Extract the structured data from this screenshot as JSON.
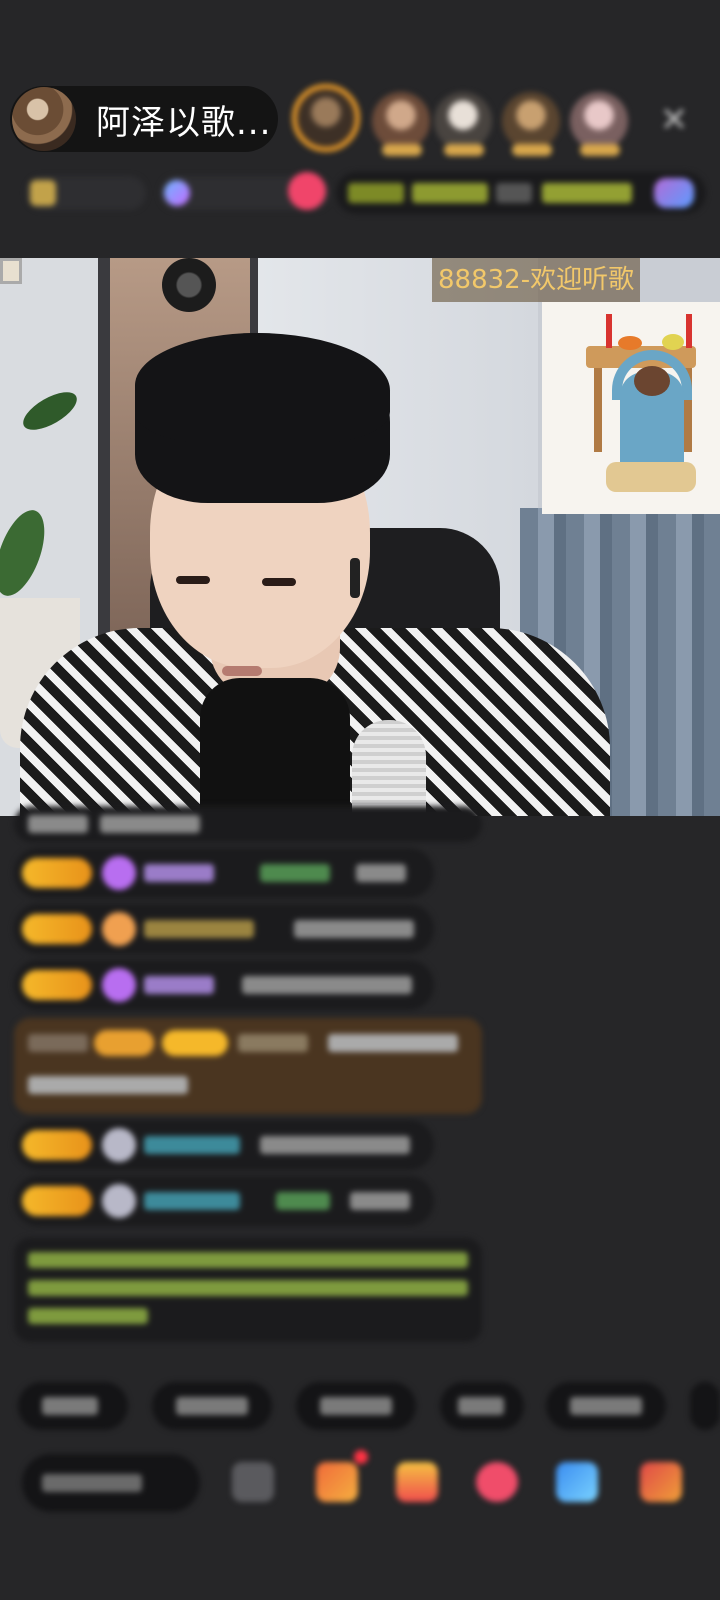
{
  "header": {
    "host_name": "阿泽以歌..."
  },
  "icons": {
    "close": "close-icon",
    "heart_badge": "fan-heart-icon",
    "gift": "gift-icon",
    "more": "more-icon"
  },
  "video": {
    "room_label": "88832-欢迎听歌"
  },
  "colors": {
    "accent": "#e89a2a",
    "room_label": "#f2c86a",
    "background": "#262628"
  }
}
